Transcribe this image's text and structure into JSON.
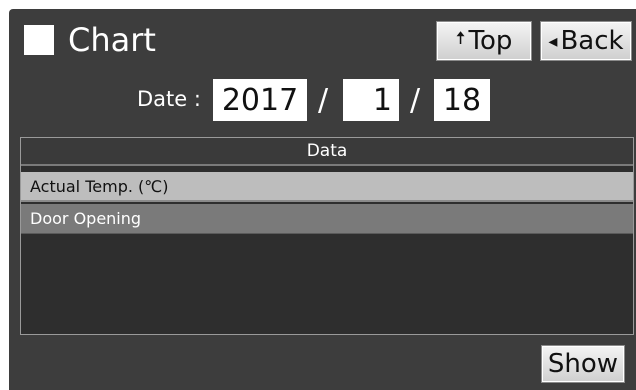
{
  "header": {
    "title": "Chart",
    "top_label": "Top",
    "top_arrow": "🠅",
    "back_label": "Back",
    "back_arrow": "◂"
  },
  "date": {
    "label": "Date :",
    "year": "2017",
    "month": "1",
    "day": "18",
    "separator": "/"
  },
  "table": {
    "header": "Data",
    "rows": [
      {
        "label": "Actual Temp. (℃)"
      },
      {
        "label": "Door Opening"
      }
    ]
  },
  "footer": {
    "show_label": "Show"
  }
}
